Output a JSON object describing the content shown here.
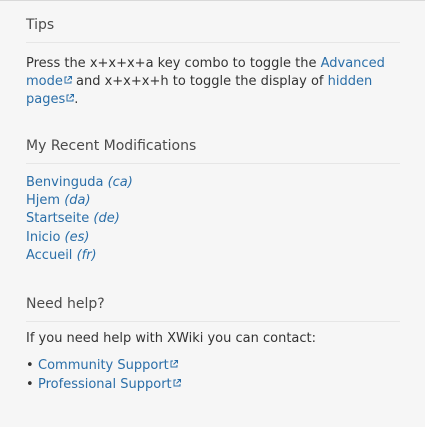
{
  "tips": {
    "title": "Tips",
    "text1": "Press the x+x+x+a key combo to toggle the ",
    "link1": "Advanced mode",
    "text2": " and x+x+x+h to toggle the display of ",
    "link2": "hidden pages",
    "text3": "."
  },
  "modifications": {
    "title": "My Recent Modifications",
    "items": [
      {
        "label": "Benvinguda",
        "lang": "(ca)"
      },
      {
        "label": "Hjem",
        "lang": "(da)"
      },
      {
        "label": "Startseite",
        "lang": "(de)"
      },
      {
        "label": "Inicio",
        "lang": "(es)"
      },
      {
        "label": "Accueil",
        "lang": "(fr)"
      }
    ]
  },
  "help": {
    "title": "Need help?",
    "intro": "If you need help with XWiki you can contact:",
    "links": [
      {
        "label": "Community Support"
      },
      {
        "label": "Professional Support"
      }
    ]
  },
  "icons": {
    "external": "external-link-icon"
  },
  "colors": {
    "link": "#2a6ea8",
    "background": "#f6f6f6"
  }
}
